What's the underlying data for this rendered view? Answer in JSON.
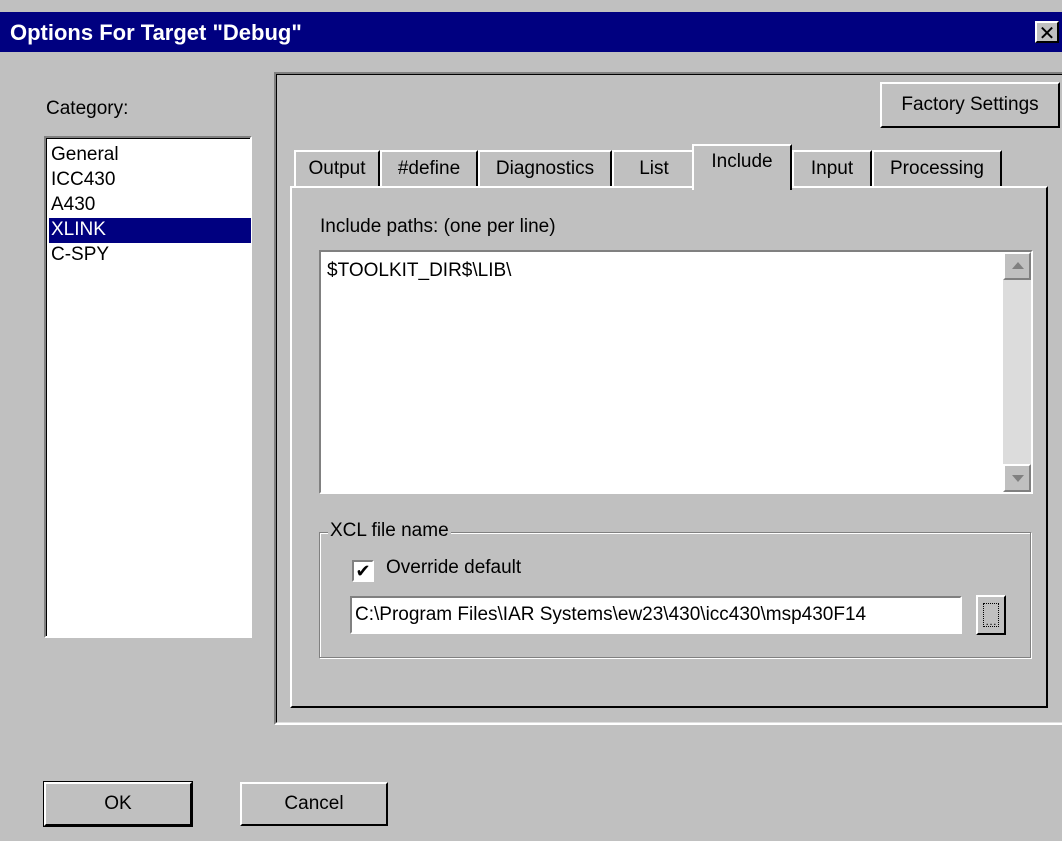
{
  "window": {
    "title": "Options For Target \"Debug\"",
    "close_glyph": "✕"
  },
  "category": {
    "label": "Category:",
    "items": [
      "General",
      "ICC430",
      "A430",
      "XLINK",
      "C-SPY"
    ],
    "selected": "XLINK"
  },
  "factory_settings_label": "Factory Settings",
  "tabs": [
    "Output",
    "#define",
    "Diagnostics",
    "List",
    "Include",
    "Input",
    "Processing"
  ],
  "active_tab": "Include",
  "include": {
    "paths_label": "Include paths:  (one per line)",
    "paths_value": "$TOOLKIT_DIR$\\LIB\\"
  },
  "xcl": {
    "group_title": "XCL file name",
    "override_label": "Override default",
    "override_checked": true,
    "checkbox_glyph": "✔",
    "path_value": "C:\\Program Files\\IAR Systems\\ew23\\430\\icc430\\msp430F14",
    "browse_glyph": "…"
  },
  "buttons": {
    "ok": "OK",
    "cancel": "Cancel"
  },
  "icons": {
    "close": "close-icon",
    "scroll_up": "scroll-up-arrow-icon",
    "scroll_down": "scroll-down-arrow-icon",
    "check": "checkmark-icon",
    "browse": "ellipsis-icon"
  }
}
